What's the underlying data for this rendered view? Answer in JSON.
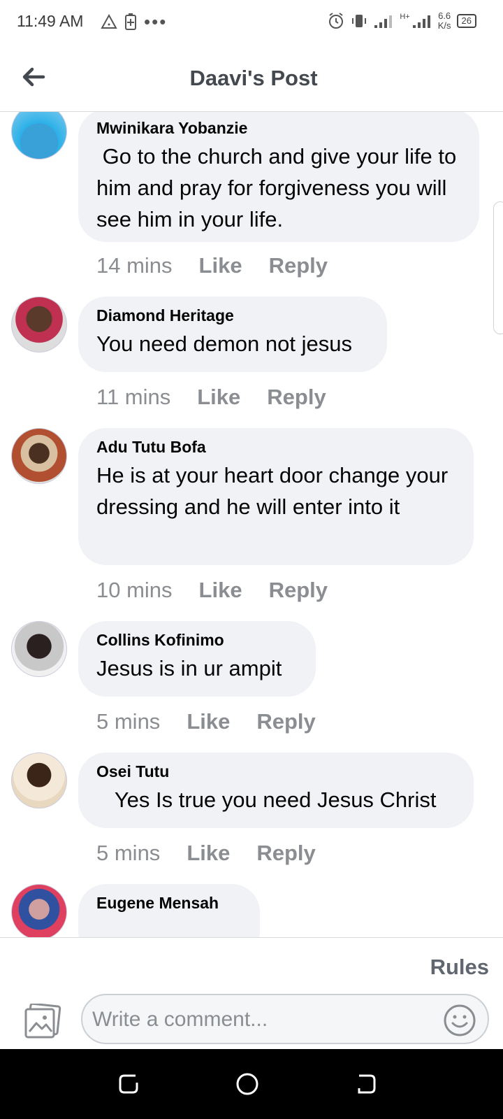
{
  "status_bar": {
    "time": "11:49 AM",
    "network_speed_value": "6.6",
    "network_speed_unit": "K/s",
    "network_type": "H+",
    "battery": "26"
  },
  "header": {
    "title": "Daavi's Post"
  },
  "comments": [
    {
      "author": "Mwinikara Yobanzie",
      "text": " Go to the church and give your life to him and pray for forgiveness you will see him in your life.",
      "time": "14 mins",
      "like": "Like",
      "reply": "Reply"
    },
    {
      "author": "Diamond Heritage",
      "text": "You need demon not jesus",
      "time": "11 mins",
      "like": "Like",
      "reply": "Reply"
    },
    {
      "author": "Adu Tutu Bofa",
      "text": "He is at your heart door change your dressing and he will enter into it",
      "time": "10 mins",
      "like": "Like",
      "reply": "Reply"
    },
    {
      "author": "Collins Kofinimo",
      "text": "Jesus is in ur ampit",
      "time": "5 mins",
      "like": "Like",
      "reply": "Reply"
    },
    {
      "author": "Osei Tutu",
      "text": "   Yes Is true you need Jesus Christ",
      "time": "5 mins",
      "like": "Like",
      "reply": "Reply"
    },
    {
      "author": "Eugene Mensah"
    }
  ],
  "footer": {
    "rules": "Rules",
    "comment_placeholder": "Write a comment..."
  },
  "icons": {
    "back": "back-arrow-icon",
    "photo": "photo-icon",
    "emoji": "emoji-icon"
  },
  "colors": {
    "bubble": "#f0f2f5",
    "meta_text": "#8a8d91",
    "title": "#444950"
  }
}
